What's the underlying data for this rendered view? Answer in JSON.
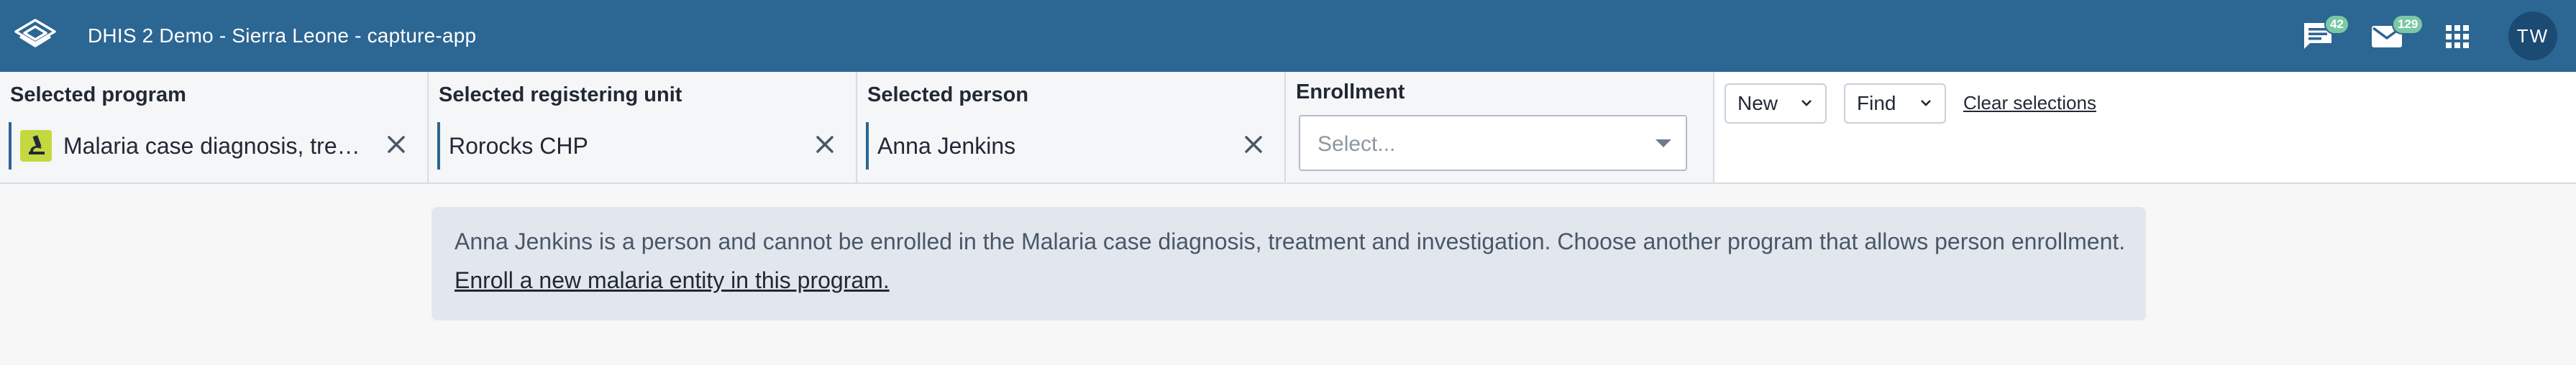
{
  "header": {
    "title": "DHIS 2 Demo - Sierra Leone - capture-app",
    "interpretations_badge": "42",
    "messages_badge": "129",
    "user_initials": "TW",
    "bg_color": "#2c6693"
  },
  "selectors": {
    "program": {
      "label": "Selected program",
      "value": "Malaria case diagnosis, treatment and investigation",
      "icon": "microscope-icon"
    },
    "org_unit": {
      "label": "Selected registering unit",
      "value": "Rorocks CHP"
    },
    "person": {
      "label": "Selected person",
      "value": "Anna Jenkins"
    },
    "enrollment": {
      "label": "Enrollment",
      "placeholder": "Select..."
    }
  },
  "actions": {
    "new_label": "New",
    "find_label": "Find",
    "clear_label": "Clear selections"
  },
  "notice": {
    "message": "Anna Jenkins is a person and cannot be enrolled in the Malaria case diagnosis, treatment and investigation. Choose another program that allows person enrollment.",
    "link": "Enroll a new malaria entity in this program."
  }
}
